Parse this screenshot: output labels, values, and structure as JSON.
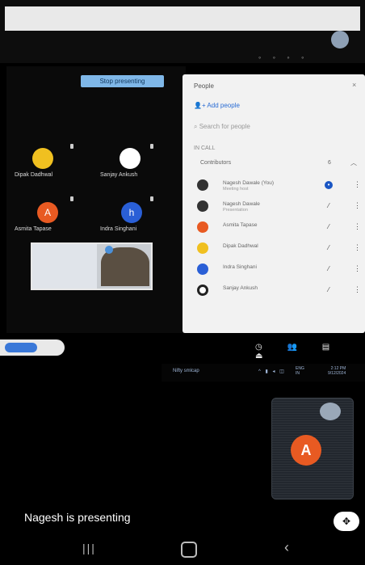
{
  "meeting": {
    "stop_presenting_label": "Stop presenting",
    "presenting_status": "Nagesh is presenting"
  },
  "tiles": [
    {
      "name": "Dipak Dadhwal",
      "initial": "",
      "color": "#f0c020"
    },
    {
      "name": "Sanjay Ankush",
      "initial": "",
      "color": "#ffffff"
    },
    {
      "name": "Asmita Tapase",
      "initial": "A",
      "color": "#e85a22"
    },
    {
      "name": "Indra Singhani",
      "initial": "h",
      "color": "#2a5fd6"
    }
  ],
  "people_panel": {
    "title": "People",
    "close": "×",
    "add_people": "Add people",
    "search_placeholder": "Search for people",
    "in_call": "IN CALL",
    "contributors": "Contributors",
    "contributors_count": "6",
    "participants": [
      {
        "name": "Nagesh Dawale (You)",
        "sub": "Meeting host",
        "color": "#333333",
        "mic": "on"
      },
      {
        "name": "Nagesh Dawale",
        "sub": "Presentation",
        "color": "#333333",
        "mic": "off"
      },
      {
        "name": "Asmita Tapase",
        "sub": "",
        "color": "#e85a22",
        "mic": "off"
      },
      {
        "name": "Dipak Dadhwal",
        "sub": "",
        "color": "#f0c020",
        "mic": "off"
      },
      {
        "name": "Indra Singhani",
        "sub": "",
        "color": "#2a5fd6",
        "mic": "off"
      },
      {
        "name": "Sanjay Ankush",
        "sub": "",
        "color": "#222222",
        "mic": "off"
      }
    ]
  },
  "taskbar": {
    "app_label": "Nifty smlcap",
    "lang_top": "ENG",
    "lang_bottom": "IN",
    "time": "2:12 PM",
    "date": "9/12/2024"
  },
  "self_view": {
    "initial": "A"
  },
  "colors": {
    "accent_blue": "#3a78d8",
    "avatar_orange": "#e85a22"
  }
}
